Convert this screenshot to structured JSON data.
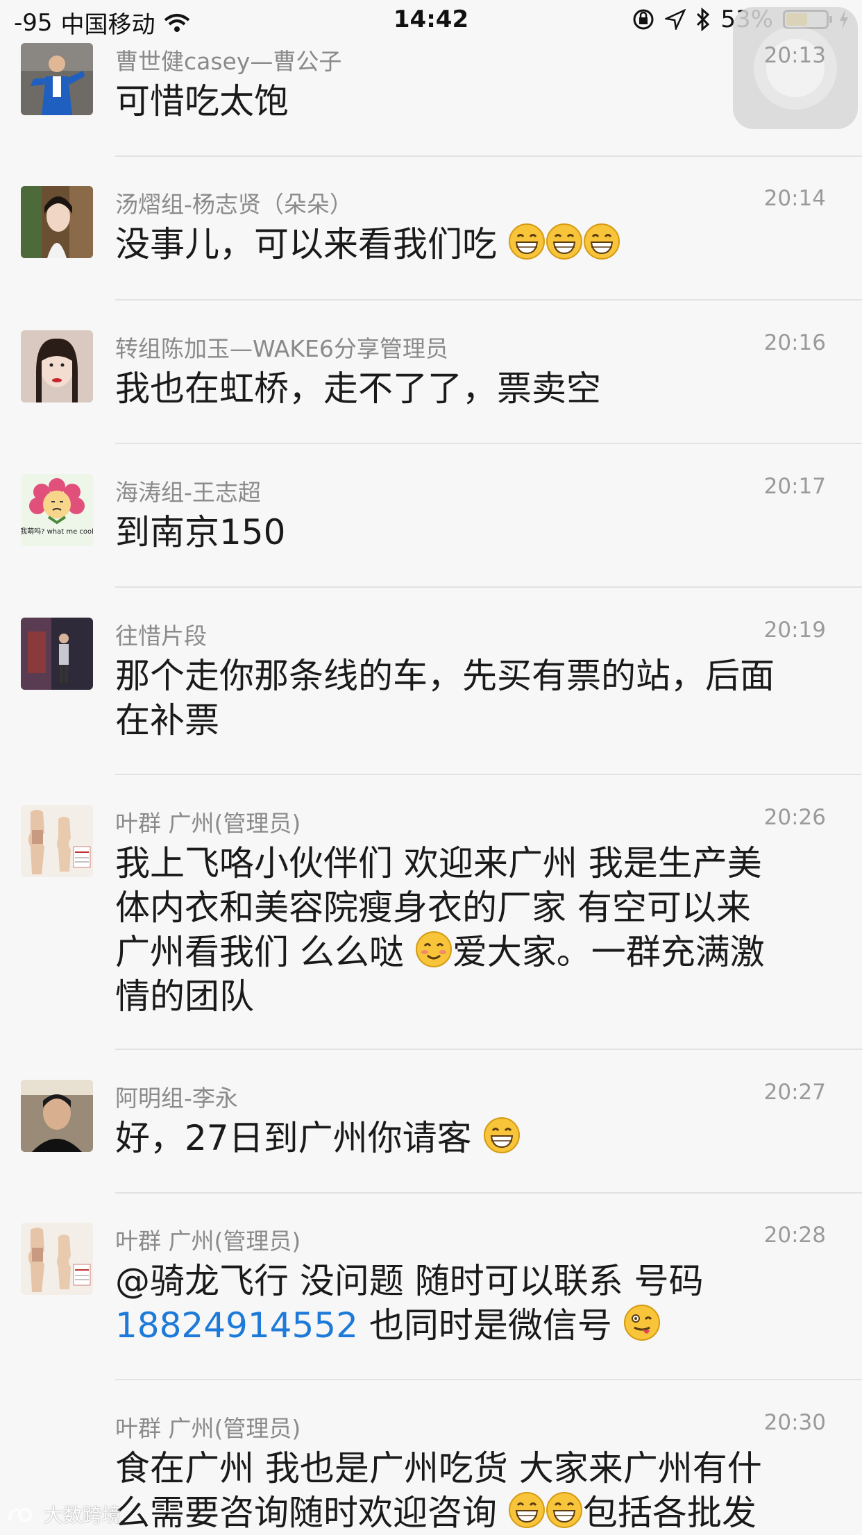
{
  "status_bar": {
    "signal": "-95",
    "carrier": "中国移动",
    "time": "14:42",
    "battery": "53%",
    "battery_level": 0.53
  },
  "messages": [
    {
      "name": "曹世健casey—曹公子",
      "time": "20:13",
      "text": "可惜吃太饱",
      "emojis": [],
      "avatar": "man-in-blue-suit"
    },
    {
      "name": "汤熠组-杨志贤（朵朵）",
      "time": "20:14",
      "text": "没事儿，可以来看我们吃",
      "emojis": [
        "grin",
        "grin",
        "grin"
      ],
      "avatar": "woman-portrait"
    },
    {
      "name": "转组陈加玉—WAKE6分享管理员",
      "time": "20:16",
      "text": "我也在虹桥，走不了了，票卖空",
      "emojis": [],
      "avatar": "woman-red-lips"
    },
    {
      "name": "海涛组-王志超",
      "time": "20:17",
      "text": "到南京150",
      "emojis": [],
      "avatar": "flower-cartoon",
      "avatar_caption": "我萌吗? what me cool"
    },
    {
      "name": "往惜片段",
      "time": "20:19",
      "text_lines": [
        "那个走你那条线的车，先买有票的站，后面",
        "在补票"
      ],
      "emojis": [],
      "avatar": "person-night-scene"
    },
    {
      "name": "叶群 广州(管理员)",
      "time": "20:26",
      "text_lines": [
        "我上飞咯小伙伴们 欢迎来广州 我是生产美",
        "体内衣和美容院瘦身衣的厂家 有空可以来",
        "广州看我们 么么哒",
        "爱大家。一群充满激",
        "情的团队"
      ],
      "emojis": [
        "blush"
      ],
      "avatar": "body-shaper-ad"
    },
    {
      "name": "阿明组-李永",
      "time": "20:27",
      "text": "好，27日到广州你请客",
      "emojis": [
        "grin"
      ],
      "avatar": "man-portrait"
    },
    {
      "name": "叶群 广州(管理员)",
      "time": "20:28",
      "text_lines": [
        "@骑龙飞行 没问题 随时可以联系 号码",
        "18824914552",
        " 也同时是微信号"
      ],
      "emojis": [
        "wink-tongue"
      ],
      "avatar": "body-shaper-ad"
    },
    {
      "name": "叶群 广州(管理员)",
      "time": "20:30",
      "text_lines": [
        "食在广州 我也是广州吃货 大家来广州有什",
        "么需要咨询随时欢迎咨询",
        "包括各批发"
      ],
      "emojis": [
        "grin",
        "grin"
      ],
      "avatar": "none"
    }
  ],
  "watermark": "大数跨境"
}
